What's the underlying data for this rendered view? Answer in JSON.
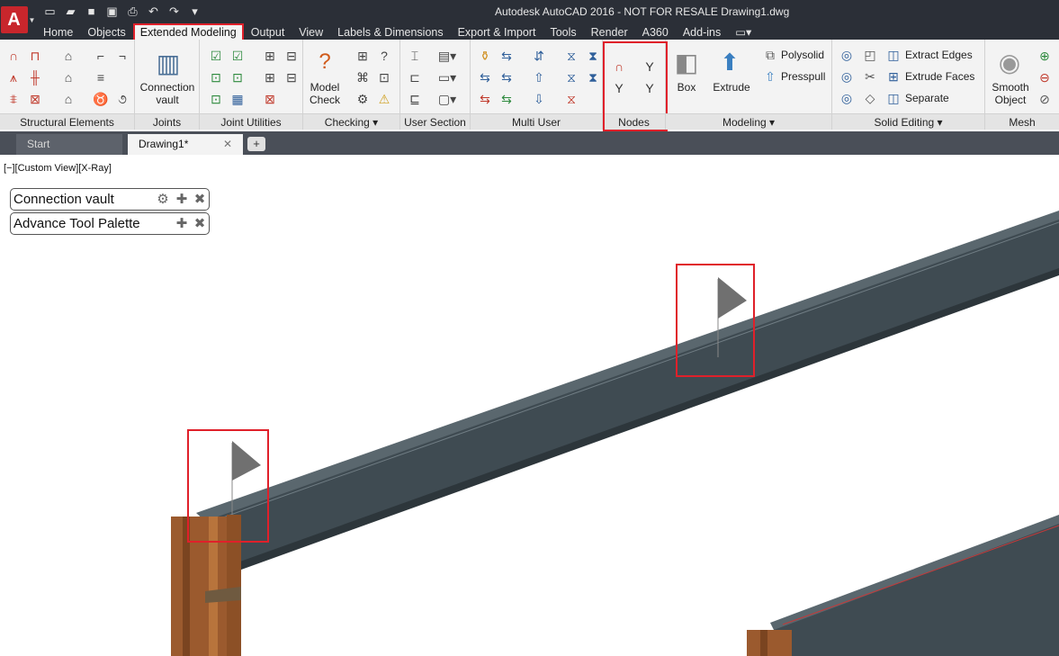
{
  "title_bar": {
    "app_menu_icon": "autocad-logo-icon",
    "text": "Autodesk AutoCAD 2016 - NOT FOR RESALE    Drawing1.dwg",
    "quick_access": [
      "new-icon",
      "open-icon",
      "save-icon",
      "save-as-icon",
      "print-icon",
      "undo-icon",
      "redo-icon",
      "customize-icon"
    ]
  },
  "ribbon_tabs": [
    {
      "label": "Home"
    },
    {
      "label": "Objects"
    },
    {
      "label": "Extended Modeling",
      "active": true
    },
    {
      "label": "Output"
    },
    {
      "label": "View"
    },
    {
      "label": "Labels & Dimensions"
    },
    {
      "label": "Export & Import"
    },
    {
      "label": "Tools"
    },
    {
      "label": "Render"
    },
    {
      "label": "A360"
    },
    {
      "label": "Add-ins"
    },
    {
      "label": "▭▾"
    }
  ],
  "panels": {
    "structural_elements": {
      "title": "Structural Elements"
    },
    "joints": {
      "title": "Joints",
      "connection_vault": "Connection vault"
    },
    "joint_utilities": {
      "title": "Joint Utilities"
    },
    "checking": {
      "title": "Checking ▾",
      "model_check": "Model Check"
    },
    "user_section": {
      "title": "User Section"
    },
    "multi_user": {
      "title": "Multi User"
    },
    "nodes": {
      "title": "Nodes"
    },
    "modeling": {
      "title": "Modeling ▾",
      "box": "Box",
      "extrude": "Extrude",
      "polysolid": "Polysolid",
      "presspull": "Presspull"
    },
    "solid_editing": {
      "title": "Solid Editing ▾",
      "extract_edges": "Extract Edges",
      "extrude_faces": "Extrude Faces",
      "separate": "Separate"
    },
    "mesh": {
      "title": "Mesh",
      "smooth_object": "Smooth Object"
    }
  },
  "doc_tabs": {
    "start": "Start",
    "active": "Drawing1*",
    "close_glyph": "✕",
    "new_glyph": "+"
  },
  "viewport": {
    "label": "[−][Custom View][X-Ray]",
    "palettes": [
      {
        "label": "Connection vault"
      },
      {
        "label": "Advance Tool Palette"
      }
    ]
  },
  "colors": {
    "accent_highlight": "#e0202a",
    "beam": "#3f4b52",
    "column": "#9b5a2e",
    "flag": "#777777"
  }
}
